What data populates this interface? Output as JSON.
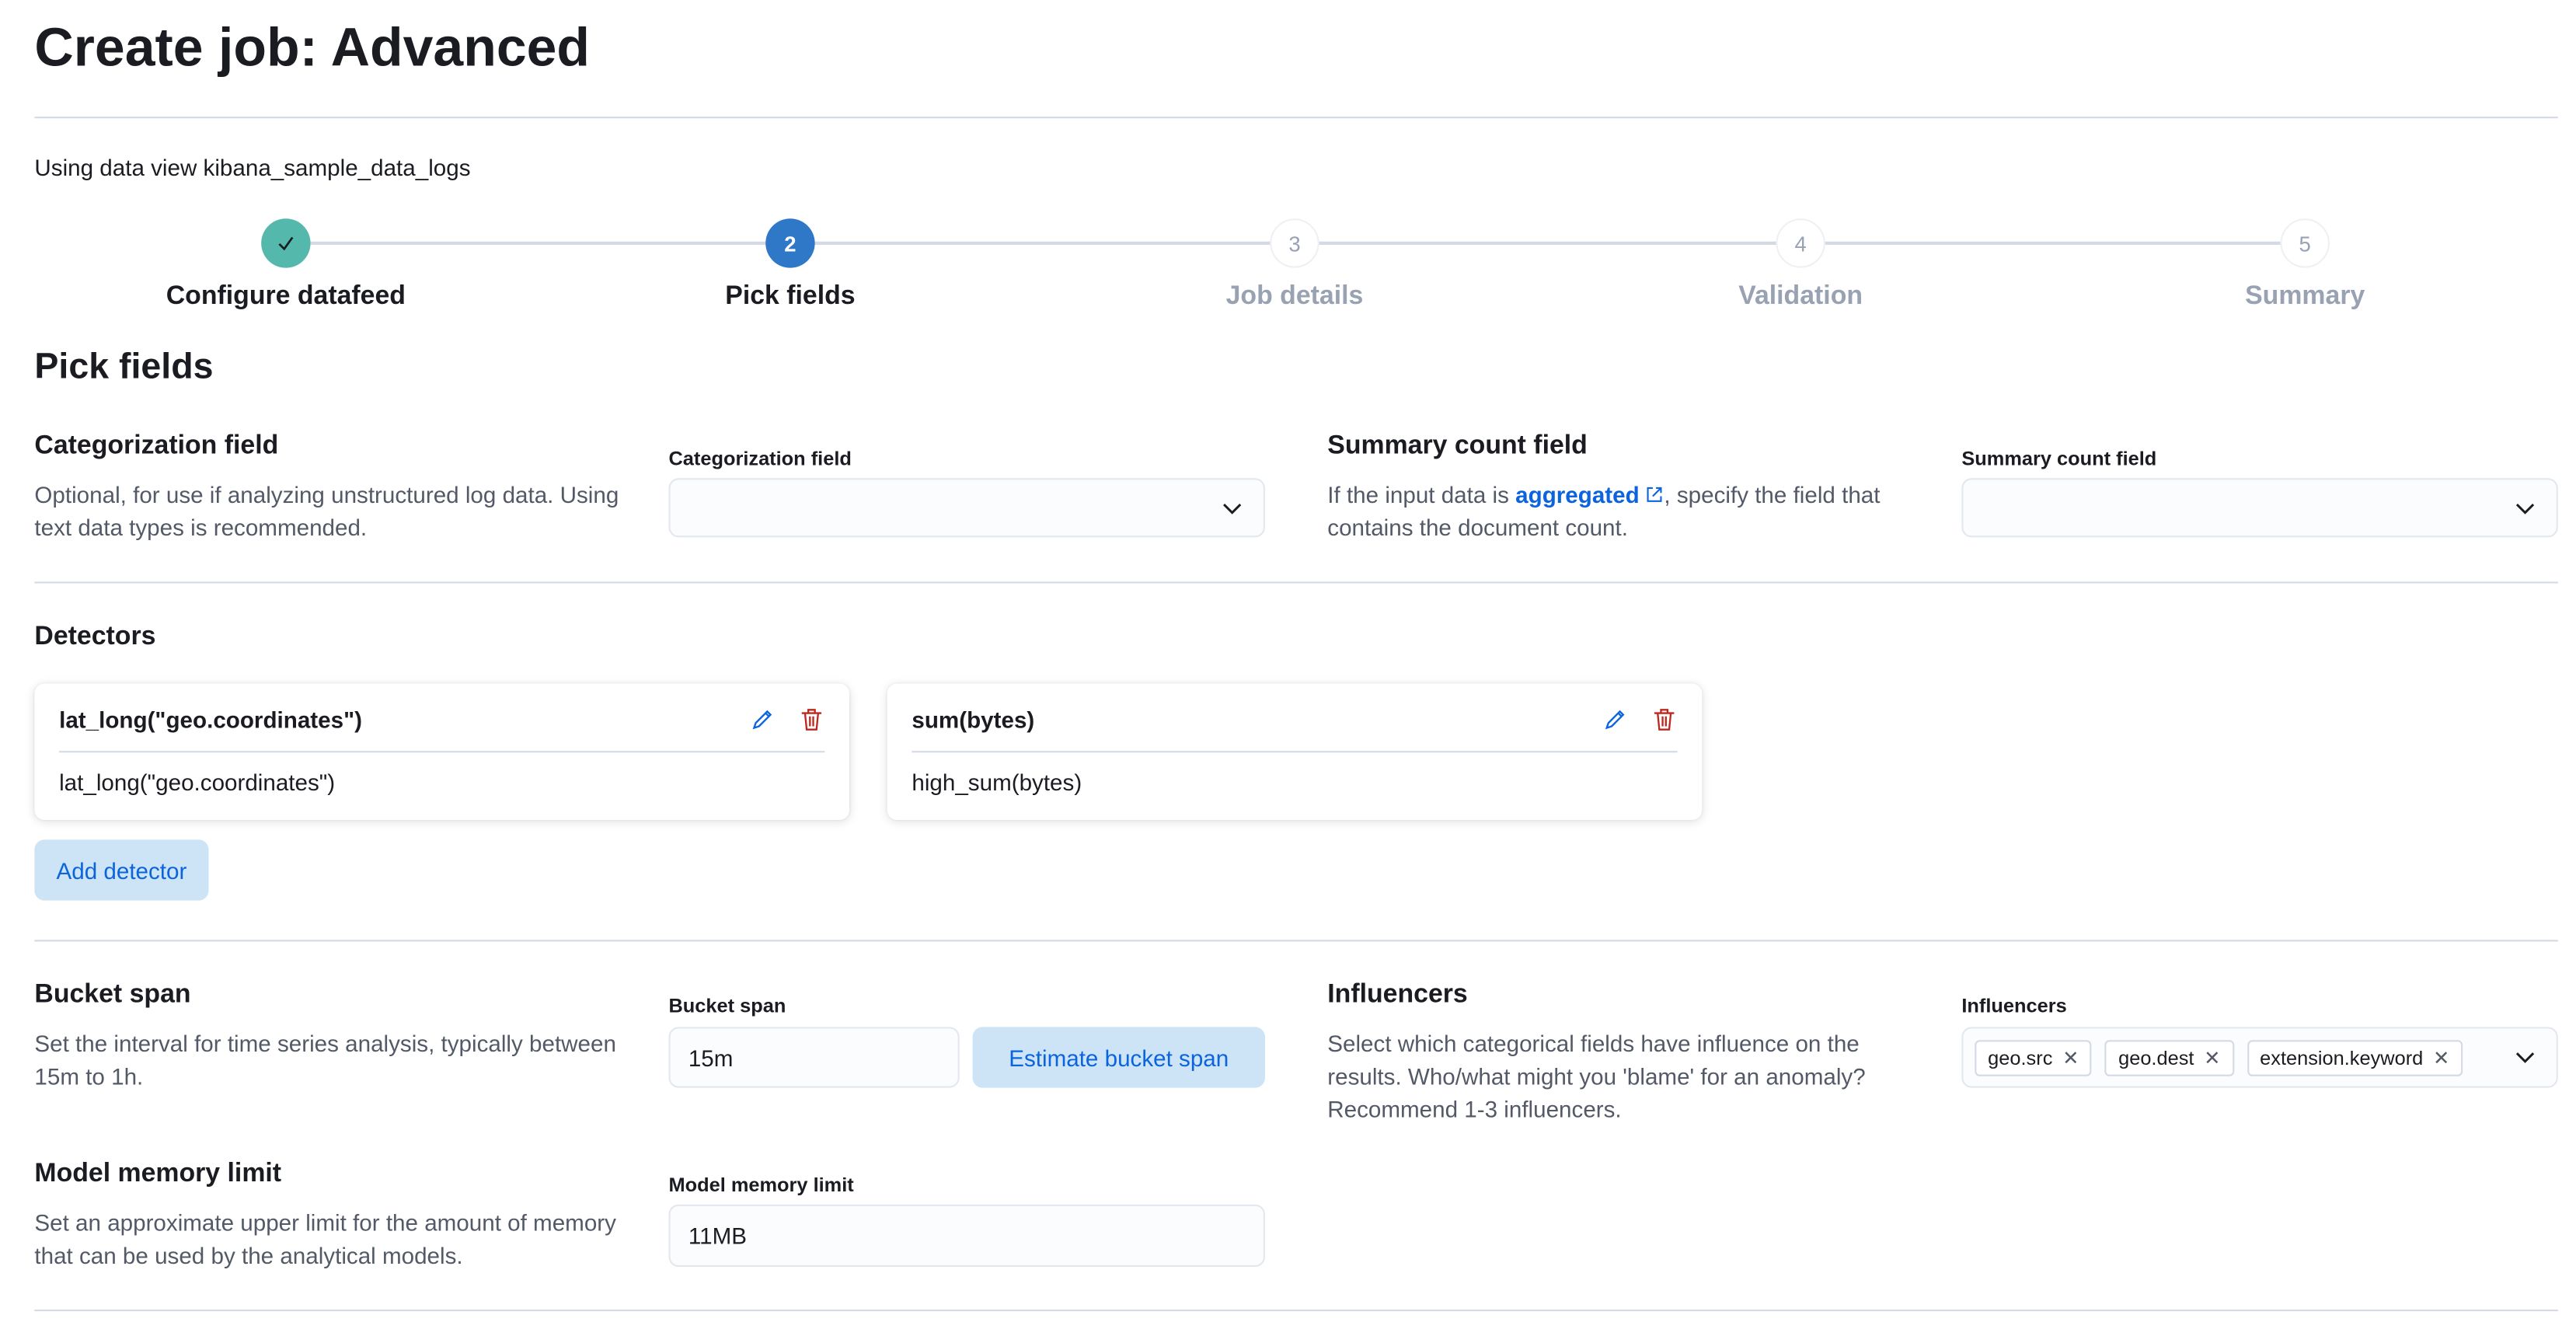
{
  "page_title": "Create job: Advanced",
  "data_view_text": "Using data view kibana_sample_data_logs",
  "steps": [
    {
      "label": "Configure datafeed",
      "status": "complete",
      "icon": "check-icon"
    },
    {
      "label": "Pick fields",
      "number": "2",
      "status": "current"
    },
    {
      "label": "Job details",
      "number": "3",
      "status": "incomplete"
    },
    {
      "label": "Validation",
      "number": "4",
      "status": "incomplete"
    },
    {
      "label": "Summary",
      "number": "5",
      "status": "incomplete"
    }
  ],
  "section_title": "Pick fields",
  "categorization": {
    "title": "Categorization field",
    "description": "Optional, for use if analyzing unstructured log data. Using text data types is recommended.",
    "field_label": "Categorization field",
    "value": ""
  },
  "summary_count": {
    "title": "Summary count field",
    "desc_before": "If the input data is ",
    "desc_link": "aggregated",
    "desc_after": ", specify the field that contains the document count.",
    "field_label": "Summary count field",
    "value": ""
  },
  "detectors": {
    "title": "Detectors",
    "items": [
      {
        "title": "lat_long(\"geo.coordinates\")",
        "description": "lat_long(\"geo.coordinates\")"
      },
      {
        "title": "sum(bytes)",
        "description": "high_sum(bytes)"
      }
    ],
    "add_label": "Add detector"
  },
  "bucket_span": {
    "title": "Bucket span",
    "description": "Set the interval for time series analysis, typically between 15m to 1h.",
    "field_label": "Bucket span",
    "value": "15m",
    "estimate_label": "Estimate bucket span"
  },
  "influencers": {
    "title": "Influencers",
    "description": "Select which categorical fields have influence on the results. Who/what might you 'blame' for an anomaly? Recommend 1-3 influencers.",
    "field_label": "Influencers",
    "values": [
      "geo.src",
      "geo.dest",
      "extension.keyword"
    ]
  },
  "model_memory": {
    "title": "Model memory limit",
    "description": "Set an approximate upper limit for the amount of memory that can be used by the analytical models.",
    "field_label": "Model memory limit",
    "value": "11MB"
  },
  "colors": {
    "accent": "#0b64dd",
    "complete": "#54b8ac",
    "current": "#2f78c8",
    "danger": "#bd271e"
  }
}
